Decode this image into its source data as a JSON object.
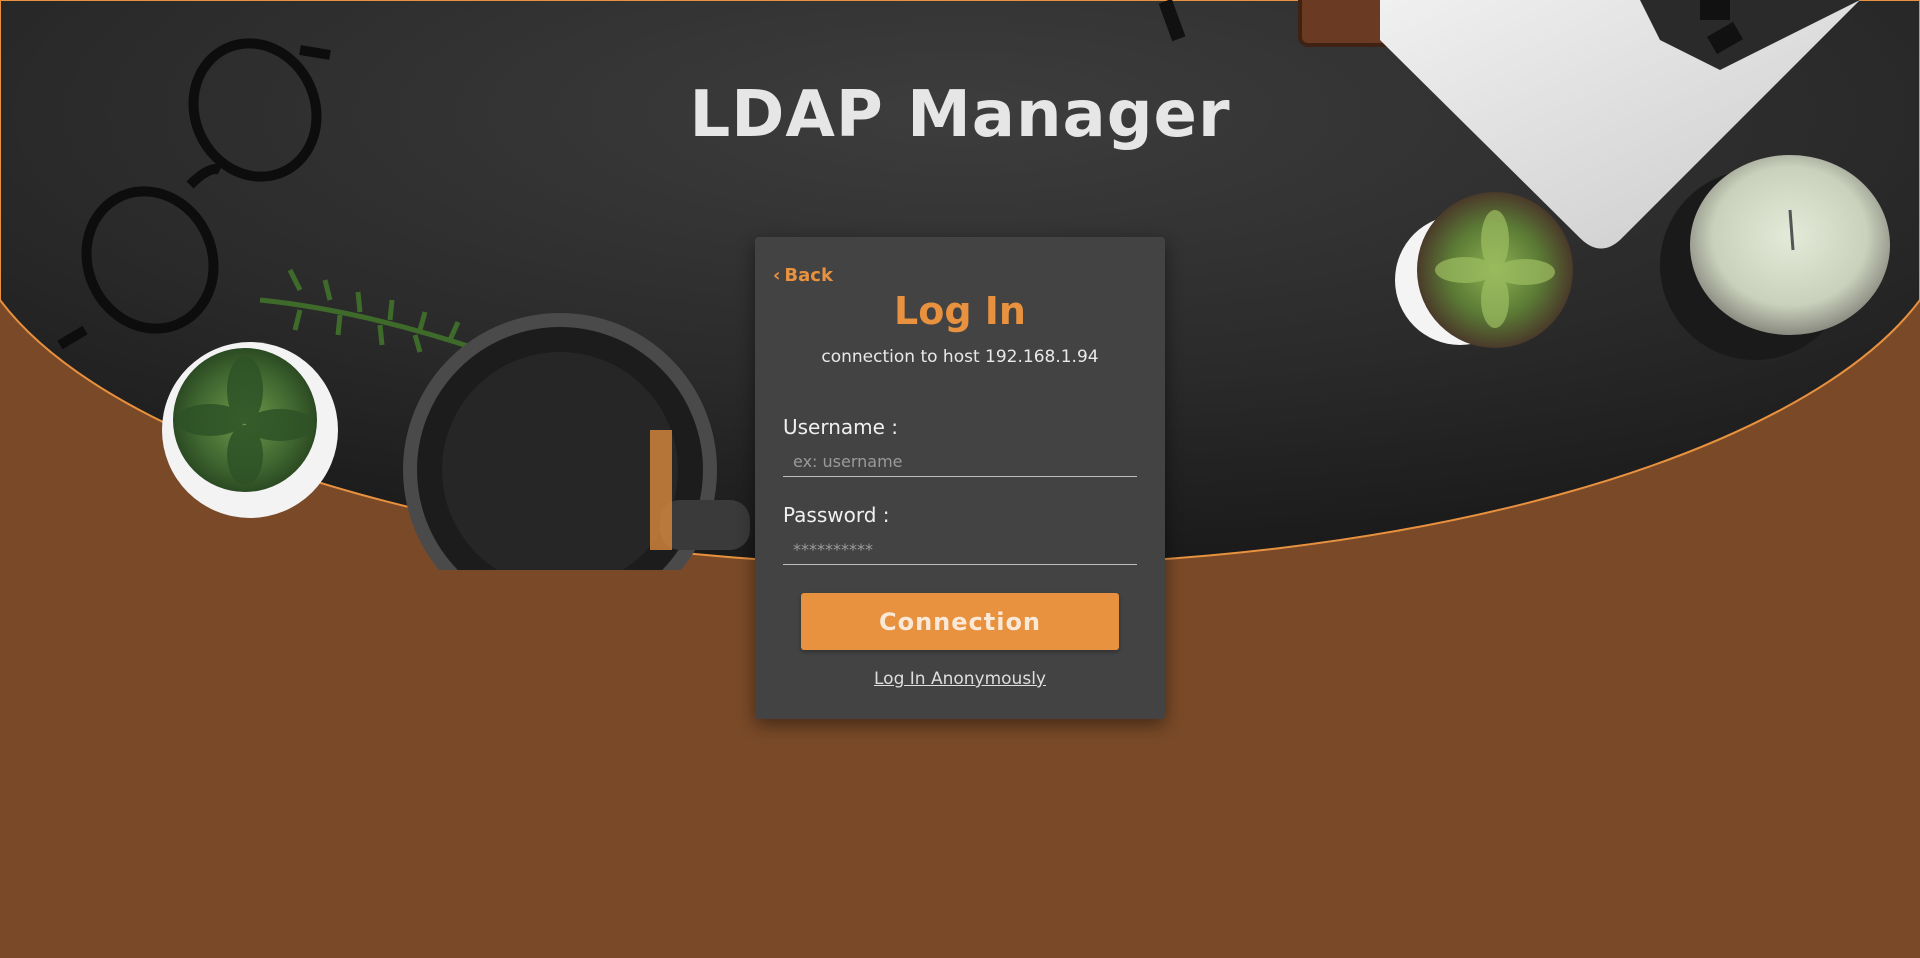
{
  "app": {
    "title": "LDAP Manager"
  },
  "login": {
    "back_label": "Back",
    "back_icon": "chevron-left-icon",
    "title": "Log In",
    "subtitle": "connection to host 192.168.1.94",
    "username": {
      "label": "Username :",
      "placeholder": "ex: username",
      "value": ""
    },
    "password": {
      "label": "Password :",
      "placeholder": "**********",
      "value": ""
    },
    "connect_label": "Connection",
    "anonymous_label": "Log In Anonymously"
  },
  "colors": {
    "accent": "#e8913f",
    "card_bg": "#434343",
    "page_bg": "#7a4a28",
    "hero_bg": "#2c2c2c"
  }
}
